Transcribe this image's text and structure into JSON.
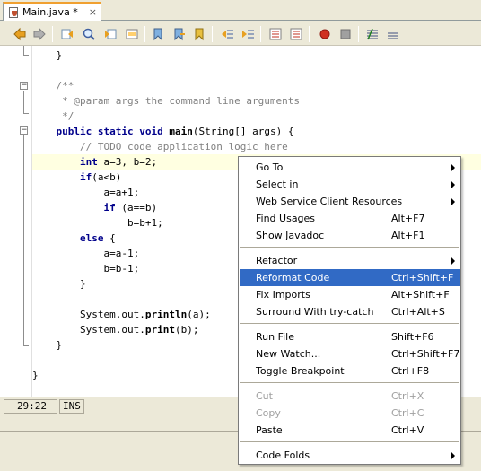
{
  "tab": {
    "title": "Main.java *",
    "icon": "java-file-icon"
  },
  "toolbar": {
    "buttons": [
      "back-icon",
      "forward-icon",
      "find-previous-icon",
      "find-icon",
      "find-next-icon",
      "toggle-highlight-icon",
      "previous-bookmark-icon",
      "next-bookmark-icon",
      "toggle-bookmark-icon",
      "shift-left-icon",
      "shift-right-icon",
      "start-macro-icon",
      "stop-macro-icon",
      "comment-icon",
      "uncomment-icon"
    ]
  },
  "code": {
    "lines": [
      {
        "text": "    }"
      },
      {
        "text": ""
      },
      {
        "text": "    /**"
      },
      {
        "text": "     * @param args the command line arguments"
      },
      {
        "text": "     */"
      },
      {
        "text": "    public static void main(String[] args) {"
      },
      {
        "text": "        // TODO code application logic here"
      },
      {
        "text": "        int a=3, b=2;"
      },
      {
        "text": "        if(a<b)"
      },
      {
        "text": "            a=a+1;"
      },
      {
        "text": "            if (a==b)"
      },
      {
        "text": "                b=b+1;"
      },
      {
        "text": "        else {"
      },
      {
        "text": "            a=a-1;"
      },
      {
        "text": "            b=b-1;"
      },
      {
        "text": "        }"
      },
      {
        "text": ""
      },
      {
        "text": "        System.out.println(a);"
      },
      {
        "text": "        System.out.print(b);"
      },
      {
        "text": "    }"
      },
      {
        "text": ""
      },
      {
        "text": "}"
      }
    ]
  },
  "status": {
    "position": "29:22",
    "mode": "INS"
  },
  "menu": {
    "items": [
      {
        "label": "Go To",
        "shortcut": "",
        "submenu": true
      },
      {
        "label": "Select in",
        "shortcut": "",
        "submenu": true
      },
      {
        "label": "Web Service Client Resources",
        "shortcut": "",
        "submenu": true
      },
      {
        "label": "Find Usages",
        "shortcut": "Alt+F7"
      },
      {
        "label": "Show Javadoc",
        "shortcut": "Alt+F1"
      },
      {
        "label": "Refactor",
        "shortcut": "",
        "submenu": true
      },
      {
        "label": "Reformat Code",
        "shortcut": "Ctrl+Shift+F"
      },
      {
        "label": "Fix Imports",
        "shortcut": "Alt+Shift+F"
      },
      {
        "label": "Surround With try-catch",
        "shortcut": "Ctrl+Alt+S"
      },
      {
        "label": "Run File",
        "shortcut": "Shift+F6"
      },
      {
        "label": "New Watch...",
        "shortcut": "Ctrl+Shift+F7"
      },
      {
        "label": "Toggle Breakpoint",
        "shortcut": "Ctrl+F8"
      },
      {
        "label": "Cut",
        "shortcut": "Ctrl+X"
      },
      {
        "label": "Copy",
        "shortcut": "Ctrl+C"
      },
      {
        "label": "Paste",
        "shortcut": "Ctrl+V"
      },
      {
        "label": "Code Folds",
        "shortcut": "",
        "submenu": true
      }
    ]
  },
  "colors": {
    "selection": "#316ac5",
    "keyword": "#00008b",
    "comment": "#808080",
    "current_line": "#ffffe1",
    "tab_accent": "#f0a030"
  }
}
